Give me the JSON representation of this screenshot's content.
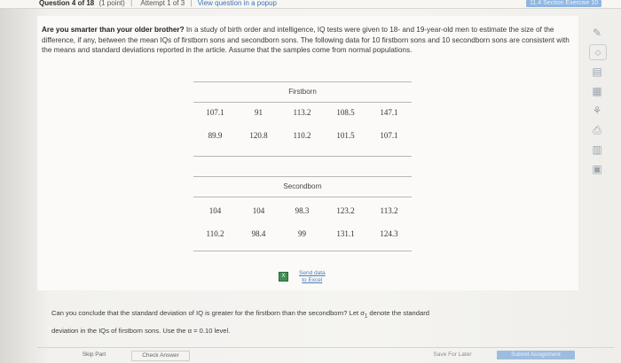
{
  "header": {
    "question": "Question 4 of 18",
    "points": "(1 point)",
    "attempt": "Attempt 1 of 3",
    "popup_link": "View question in a popup",
    "section": "11.4 Section Exercise 10"
  },
  "problem": {
    "bold_lead": "Are you smarter than your older brother?",
    "text": " In a study of birth order and intelligence, IQ tests were given to 18- and 19-year-old men to estimate the size of the difference, if any, between the mean IQs of firstborn sons and secondborn sons. The following data for 10 firstborn sons and 10 secondborn sons are consistent with the means and standard deviations reported in the article. Assume that the samples come from normal populations."
  },
  "firstborn": {
    "title": "Firstborn",
    "rows": [
      [
        "107.1",
        "91",
        "113.2",
        "108.5",
        "147.1"
      ],
      [
        "89.9",
        "120.8",
        "110.2",
        "101.5",
        "107.1"
      ]
    ]
  },
  "secondborn": {
    "title": "Secondborn",
    "rows": [
      [
        "104",
        "104",
        "98.3",
        "123.2",
        "113.2"
      ],
      [
        "110.2",
        "98.4",
        "99",
        "131.1",
        "124.3"
      ]
    ]
  },
  "excel": {
    "line1": "Send data",
    "line2": "to Excel"
  },
  "prompt": {
    "line1": "Can you conclude that the standard deviation of IQ is greater for the firstborn than the secondborn? Let σ",
    "sub": "1",
    "line1b": " denote the standard",
    "line2": "deviation in the IQs of firstborn sons. Use the α = 0.10 level."
  },
  "buttons": {
    "skip": "Skip Part",
    "check": "Check Answer",
    "save": "Save For Later",
    "submit": "Submit Assignment"
  }
}
